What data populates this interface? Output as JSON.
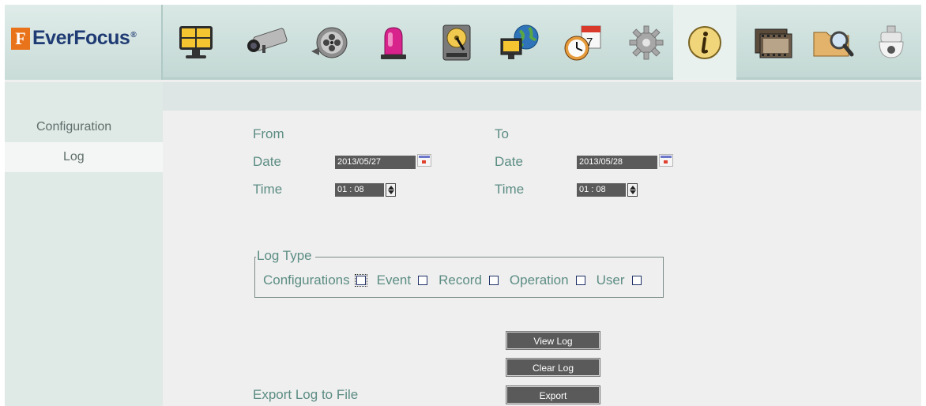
{
  "brand": {
    "name": "EverFocus",
    "mark": "F",
    "registered": "®"
  },
  "toolbar": {
    "items": [
      {
        "name": "live-view-icon"
      },
      {
        "name": "camera-icon"
      },
      {
        "name": "playback-reel-icon"
      },
      {
        "name": "alarm-beacon-icon"
      },
      {
        "name": "hard-disk-icon"
      },
      {
        "name": "network-globe-icon"
      },
      {
        "name": "schedule-calendar-clock-icon"
      },
      {
        "name": "settings-gear-icon"
      },
      {
        "name": "information-icon",
        "active": true
      },
      {
        "name": "film-backup-icon"
      },
      {
        "name": "folder-search-icon"
      },
      {
        "name": "ptz-dome-camera-icon"
      }
    ]
  },
  "sidebar": {
    "items": [
      {
        "label": "Configuration"
      },
      {
        "label": "Log",
        "selected": true
      }
    ]
  },
  "log": {
    "from_label": "From",
    "to_label": "To",
    "date_label": "Date",
    "time_label": "Time",
    "from_date": "2013/05/27",
    "from_time": "01 : 08",
    "to_date": "2013/05/28",
    "to_time": "01 : 08",
    "log_type_label": "Log Type",
    "types": [
      {
        "label": "Configurations",
        "checked": false,
        "focused": true
      },
      {
        "label": "Event",
        "checked": false
      },
      {
        "label": "Record",
        "checked": false
      },
      {
        "label": "Operation",
        "checked": false
      },
      {
        "label": "User",
        "checked": false
      }
    ],
    "view_button": "View Log",
    "clear_button": "Clear Log",
    "export_label": "Export Log to File",
    "export_button": "Export"
  },
  "colors": {
    "accent_text": "#5c8d83",
    "field_bg": "#5a5a5a",
    "header_bg": "#c3d8d4",
    "logo_orange": "#e8731a",
    "logo_navy": "#1f3b73"
  }
}
